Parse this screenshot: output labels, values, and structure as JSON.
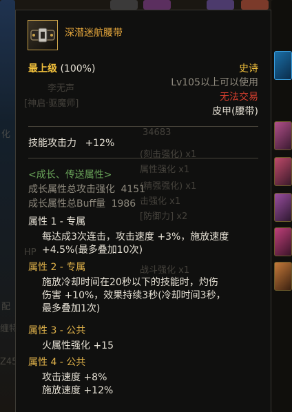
{
  "item": {
    "name": "深潜迷航腰带",
    "grade": "最上级",
    "grade_pct": "(100%)",
    "rarity": "史诗",
    "level_req": "Lv105以上可以使用",
    "trade": "无法交易",
    "type": "皮甲(腰带)"
  },
  "skill_attack": {
    "label": "技能攻击力",
    "value": "+12%"
  },
  "growth": {
    "title": "<成长、传送属性>",
    "attack_label": "成长属性总攻击强化",
    "attack_value": "4151",
    "buff_label": "成长属性总Buff量",
    "buff_value": "1986"
  },
  "attributes": [
    {
      "title": "属性 1 - 专属",
      "lines": [
        "每达成3次连击，攻击速度 +3%，施放速度",
        "+4.5%(最多叠加10次)"
      ]
    },
    {
      "title": "属性 2 - 专属",
      "lines": [
        "施放冷却时间在20秒以下的技能时，灼伤",
        "伤害 +10%，效果持续3秒(冷却时间3秒，",
        "最多叠加1次)"
      ]
    },
    {
      "title": "属性 3 - 公共",
      "lines": [
        "火属性强化 +15"
      ]
    },
    {
      "title": "属性 4 - 公共",
      "lines": [
        "攻击速度 +8%",
        "施放速度 +12%"
      ]
    }
  ],
  "background": {
    "char_name": "李无声",
    "char_class": "[神启·驱魔师]",
    "left_chars": [
      "化"
    ],
    "stat_number": "34683",
    "item_fragments": [
      "(刻击强化) x1",
      "属性强化 x1",
      "(精强强化) x1",
      "击强化 x1",
      "[防御力] x2",
      "HP",
      "战斗强化 x1"
    ],
    "left_bottom": [
      "配",
      "缠特",
      "Z45"
    ]
  },
  "colors": {
    "gold": "#f2c13c",
    "orange_name": "#e3a53b",
    "red": "#d23e2e",
    "green": "#6aa55a",
    "gray": "#8f8a7e"
  }
}
